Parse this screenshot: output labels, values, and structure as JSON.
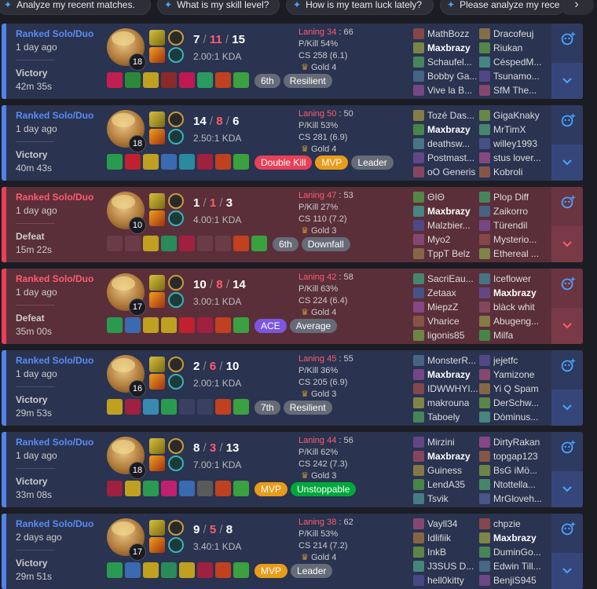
{
  "suggestions": [
    {
      "label": "Analyze my recent matches."
    },
    {
      "label": "What is my skill level?"
    },
    {
      "label": "How is my team luck lately?"
    },
    {
      "label": "Please analyze my recent"
    }
  ],
  "colors": {
    "win": "#5383e8",
    "loss": "#e84057",
    "accent": "#4aa3ff"
  },
  "matches": [
    {
      "outcome": "win",
      "queue": "Ranked Solo/Duo",
      "ago": "1 day ago",
      "result": "Victory",
      "duration": "42m 35s",
      "level": "18",
      "k": "7",
      "d": "11",
      "a": "15",
      "ratio": "2.00:1 KDA",
      "laning_label": "Laning 34",
      "laning_other": "66",
      "pkill": "P/Kill 54%",
      "cs": "CS 258 (6.1)",
      "tier": "Gold 4",
      "items": [
        "#c02050",
        "#2a8a3a",
        "#c0a020",
        "#8a2a2a",
        "#c01850",
        "#2a9a60",
        "#c04020",
        "#3aa040"
      ],
      "badges": [
        {
          "t": "6th",
          "c": "gray"
        },
        {
          "t": "Resilient",
          "c": "gray"
        }
      ],
      "team1": [
        [
          "MathBozz",
          0
        ],
        [
          "Maxbrazy",
          1
        ],
        [
          "Schaufel...",
          0
        ],
        [
          "Bobby Ga...",
          0
        ],
        [
          "Vive la B...",
          0
        ]
      ],
      "team2": [
        [
          "Dracofeuj",
          0
        ],
        [
          "Riukan",
          0
        ],
        [
          "CéspedM...",
          0
        ],
        [
          "Tsunamo...",
          0
        ],
        [
          "SfM The...",
          0
        ]
      ]
    },
    {
      "outcome": "win",
      "queue": "Ranked Solo/Duo",
      "ago": "1 day ago",
      "result": "Victory",
      "duration": "40m 43s",
      "level": "18",
      "k": "14",
      "d": "8",
      "a": "6",
      "ratio": "2.50:1 KDA",
      "laning_label": "Laning 50",
      "laning_other": "50",
      "pkill": "P/Kill 53%",
      "cs": "CS 281 (6.9)",
      "tier": "Gold 4",
      "items": [
        "#2a9a50",
        "#c02030",
        "#c0a020",
        "#3a6ab0",
        "#2a8aa0",
        "#a02040",
        "#c04020",
        "#3aa040"
      ],
      "badges": [
        {
          "t": "Double Kill",
          "c": "red"
        },
        {
          "t": "MVP",
          "c": "gold"
        },
        {
          "t": "Leader",
          "c": "gray"
        }
      ],
      "team1": [
        [
          "Tozé Das...",
          0
        ],
        [
          "Maxbrazy",
          1
        ],
        [
          "deathsw...",
          0
        ],
        [
          "Postmast...",
          0
        ],
        [
          "oO Generis",
          0
        ]
      ],
      "team2": [
        [
          "GigaKnaky",
          0
        ],
        [
          "MrTimX",
          0
        ],
        [
          "willey1993",
          0
        ],
        [
          "stus lover...",
          0
        ],
        [
          "Kobroli",
          0
        ]
      ]
    },
    {
      "outcome": "loss",
      "queue": "Ranked Solo/Duo",
      "ago": "1 day ago",
      "result": "Defeat",
      "duration": "15m 22s",
      "level": "10",
      "k": "1",
      "d": "1",
      "a": "3",
      "ratio": "4.00:1 KDA",
      "laning_label": "Laning 47",
      "laning_other": "53",
      "pkill": "P/Kill 27%",
      "cs": "CS 110 (7.2)",
      "tier": "Gold 3",
      "items": [
        "",
        "",
        "#c0a020",
        "#2a8a5a",
        "#a02040",
        "",
        "",
        "#c04020",
        "#3aa040"
      ],
      "badges": [
        {
          "t": "6th",
          "c": "gray"
        },
        {
          "t": "Downfall",
          "c": "gray"
        }
      ],
      "team1": [
        [
          "ΘΙΘ",
          0
        ],
        [
          "Maxbrazy",
          1
        ],
        [
          "Malzbier...",
          0
        ],
        [
          "Myo2",
          0
        ],
        [
          "TppT Belz",
          0
        ]
      ],
      "team2": [
        [
          "Plop Diff",
          0
        ],
        [
          "Zaikorro",
          0
        ],
        [
          "Türendil",
          0
        ],
        [
          "Mysterio...",
          0
        ],
        [
          "Ethereal ...",
          0
        ]
      ]
    },
    {
      "outcome": "loss",
      "queue": "Ranked Solo/Duo",
      "ago": "1 day ago",
      "result": "Defeat",
      "duration": "35m 00s",
      "level": "17",
      "k": "10",
      "d": "8",
      "a": "14",
      "ratio": "3.00:1 KDA",
      "laning_label": "Laning 42",
      "laning_other": "58",
      "pkill": "P/Kill 63%",
      "cs": "CS 224 (6.4)",
      "tier": "Gold 4",
      "items": [
        "#2a9a50",
        "#3a6ab0",
        "#c0a020",
        "#c0a020",
        "#c02030",
        "#a02040",
        "#c04020",
        "#3aa040"
      ],
      "badges": [
        {
          "t": "ACE",
          "c": "purple"
        },
        {
          "t": "Average",
          "c": "gray"
        }
      ],
      "team1": [
        [
          "SacriEau...",
          0
        ],
        [
          "Zetaax",
          0
        ],
        [
          "MiepzZ",
          0
        ],
        [
          "Vharice",
          0
        ],
        [
          "ligonis85",
          0
        ]
      ],
      "team2": [
        [
          "Iceflower",
          0
        ],
        [
          "Maxbrazy",
          1
        ],
        [
          "blàck whit",
          0
        ],
        [
          "Abugeng...",
          0
        ],
        [
          "Milfa",
          0
        ]
      ]
    },
    {
      "outcome": "win",
      "queue": "Ranked Solo/Duo",
      "ago": "1 day ago",
      "result": "Victory",
      "duration": "29m 53s",
      "level": "16",
      "k": "2",
      "d": "6",
      "a": "10",
      "ratio": "2.00:1 KDA",
      "laning_label": "Laning 45",
      "laning_other": "55",
      "pkill": "P/Kill 36%",
      "cs": "CS 205 (6.9)",
      "tier": "Gold 3",
      "items": [
        "#c0a020",
        "#a02040",
        "#3a8ab0",
        "#2a9a50",
        "",
        "",
        "#c04020",
        "#3aa040"
      ],
      "badges": [
        {
          "t": "7th",
          "c": "gray"
        },
        {
          "t": "Resilient",
          "c": "gray"
        }
      ],
      "team1": [
        [
          "MonsterR...",
          0
        ],
        [
          "Maxbrazy",
          1
        ],
        [
          "IDWWHYI...",
          0
        ],
        [
          "makrouna",
          0
        ],
        [
          "Taboely",
          0
        ]
      ],
      "team2": [
        [
          "jejetfc",
          0
        ],
        [
          "Yamizone",
          0
        ],
        [
          "Yi Q Spam",
          0
        ],
        [
          "DerSchw...",
          0
        ],
        [
          "Dòminus...",
          0
        ]
      ]
    },
    {
      "outcome": "win",
      "queue": "Ranked Solo/Duo",
      "ago": "1 day ago",
      "result": "Victory",
      "duration": "33m 08s",
      "level": "18",
      "k": "8",
      "d": "3",
      "a": "13",
      "ratio": "7.00:1 KDA",
      "laning_label": "Laning 44",
      "laning_other": "56",
      "pkill": "P/Kill 62%",
      "cs": "CS 242 (7.3)",
      "tier": "Gold 3",
      "items": [
        "#a02040",
        "#c0a020",
        "#2a9a50",
        "#c02070",
        "#3a6ab0",
        "#5a5a5a",
        "#c04020",
        "#3aa040"
      ],
      "badges": [
        {
          "t": "MVP",
          "c": "gold"
        },
        {
          "t": "Unstoppable",
          "c": "green"
        }
      ],
      "team1": [
        [
          "Mirzini",
          0
        ],
        [
          "Maxbrazy",
          1
        ],
        [
          "Guiness",
          0
        ],
        [
          "LendA35",
          0
        ],
        [
          "Tsvik",
          0
        ]
      ],
      "team2": [
        [
          "DirtyRakan",
          0
        ],
        [
          "topgap123",
          0
        ],
        [
          "BsG iMö...",
          0
        ],
        [
          "Ntottella...",
          0
        ],
        [
          "MrGloveh...",
          0
        ]
      ]
    },
    {
      "outcome": "win",
      "queue": "Ranked Solo/Duo",
      "ago": "2 days ago",
      "result": "Victory",
      "duration": "29m 51s",
      "level": "17",
      "k": "9",
      "d": "5",
      "a": "8",
      "ratio": "3.40:1 KDA",
      "laning_label": "Laning 38",
      "laning_other": "62",
      "pkill": "P/Kill 53%",
      "cs": "CS 214 (7.2)",
      "tier": "Gold 4",
      "items": [
        "#2a9a50",
        "#3a6ab0",
        "#c0a020",
        "#2a8a5a",
        "#c0a020",
        "#a02040",
        "#c04020",
        "#3aa040"
      ],
      "badges": [
        {
          "t": "MVP",
          "c": "gold"
        },
        {
          "t": "Leader",
          "c": "gray"
        }
      ],
      "team1": [
        [
          "Vayll34",
          0
        ],
        [
          "Idlifiik",
          0
        ],
        [
          "InkB",
          0
        ],
        [
          "J3SUS D...",
          0
        ],
        [
          "hell0kitty",
          0
        ]
      ],
      "team2": [
        [
          "chpzie",
          0
        ],
        [
          "Maxbrazy",
          1
        ],
        [
          "DuminGo...",
          0
        ],
        [
          "Edwin Till...",
          0
        ],
        [
          "BenjiS945",
          0
        ]
      ]
    }
  ]
}
